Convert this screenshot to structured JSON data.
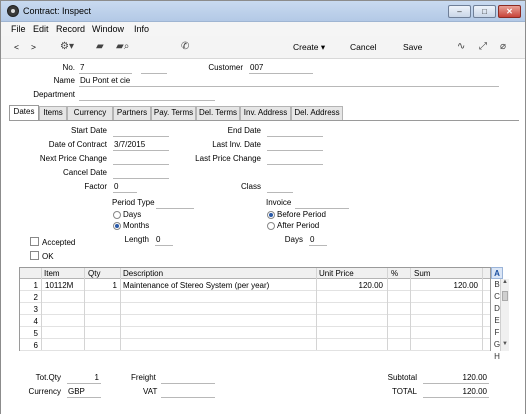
{
  "window": {
    "title": "Contract: Inspect",
    "minimize": "–",
    "maximize": "□",
    "close": "✕"
  },
  "menu": [
    "File",
    "Edit",
    "Record",
    "Window",
    "Info"
  ],
  "toolbar": {
    "back": "<",
    "forward": ">",
    "create": "Create",
    "cancel": "Cancel",
    "save": "Save"
  },
  "header": {
    "no_label": "No.",
    "no_value": "7",
    "customer_label": "Customer",
    "customer_value": "007",
    "name_label": "Name",
    "name_value": "Du Pont et cie",
    "department_label": "Department",
    "department_value": ""
  },
  "tabs": [
    "Dates",
    "Items",
    "Currency",
    "Partners",
    "Pay. Terms",
    "Del. Terms",
    "Inv. Address",
    "Del. Address"
  ],
  "dates": {
    "start_date_label": "Start Date",
    "start_date_value": "",
    "end_date_label": "End Date",
    "end_date_value": "",
    "date_of_contract_label": "Date of Contract",
    "date_of_contract_value": "3/7/2015",
    "last_inv_date_label": "Last Inv. Date",
    "last_inv_date_value": "",
    "next_price_change_label": "Next Price Change",
    "next_price_change_value": "",
    "last_price_change_label": "Last Price Change",
    "last_price_change_value": "",
    "cancel_date_label": "Cancel Date",
    "cancel_date_value": "",
    "factor_label": "Factor",
    "factor_value": "0",
    "class_label": "Class",
    "class_value": "",
    "period_type_label": "Period Type",
    "period_days": "Days",
    "period_months": "Months",
    "invoice_label": "Invoice",
    "invoice_before": "Before Period",
    "invoice_after": "After Period",
    "accepted_label": "Accepted",
    "ok_label": "OK",
    "length_label": "Length",
    "length_value": "0",
    "days_label": "Days",
    "days_value": "0"
  },
  "grid": {
    "headers": {
      "item": "Item",
      "qty": "Qty",
      "description": "Description",
      "unit_price": "Unit Price",
      "pct": "%",
      "sum": "Sum"
    },
    "rows": [
      {
        "n": "1",
        "item": "10112M",
        "qty": "1",
        "description": "Maintenance of Stereo System (per year)",
        "unit_price": "120.00",
        "pct": "",
        "sum": "120.00"
      },
      {
        "n": "2",
        "item": "",
        "qty": "",
        "description": "",
        "unit_price": "",
        "pct": "",
        "sum": ""
      },
      {
        "n": "3",
        "item": "",
        "qty": "",
        "description": "",
        "unit_price": "",
        "pct": "",
        "sum": ""
      },
      {
        "n": "4",
        "item": "",
        "qty": "",
        "description": "",
        "unit_price": "",
        "pct": "",
        "sum": ""
      },
      {
        "n": "5",
        "item": "",
        "qty": "",
        "description": "",
        "unit_price": "",
        "pct": "",
        "sum": ""
      },
      {
        "n": "6",
        "item": "",
        "qty": "",
        "description": "",
        "unit_price": "",
        "pct": "",
        "sum": ""
      }
    ],
    "letters": [
      "A",
      "B",
      "C",
      "D",
      "E",
      "F",
      "G",
      "H"
    ],
    "active_letter": "A"
  },
  "footer": {
    "tot_qty_label": "Tot.Qty",
    "tot_qty_value": "1",
    "freight_label": "Freight",
    "freight_value": "",
    "subtotal_label": "Subtotal",
    "subtotal_value": "120.00",
    "currency_label": "Currency",
    "currency_value": "GBP",
    "vat_label": "VAT",
    "vat_value": "",
    "total_label": "TOTAL",
    "total_value": "120.00"
  }
}
